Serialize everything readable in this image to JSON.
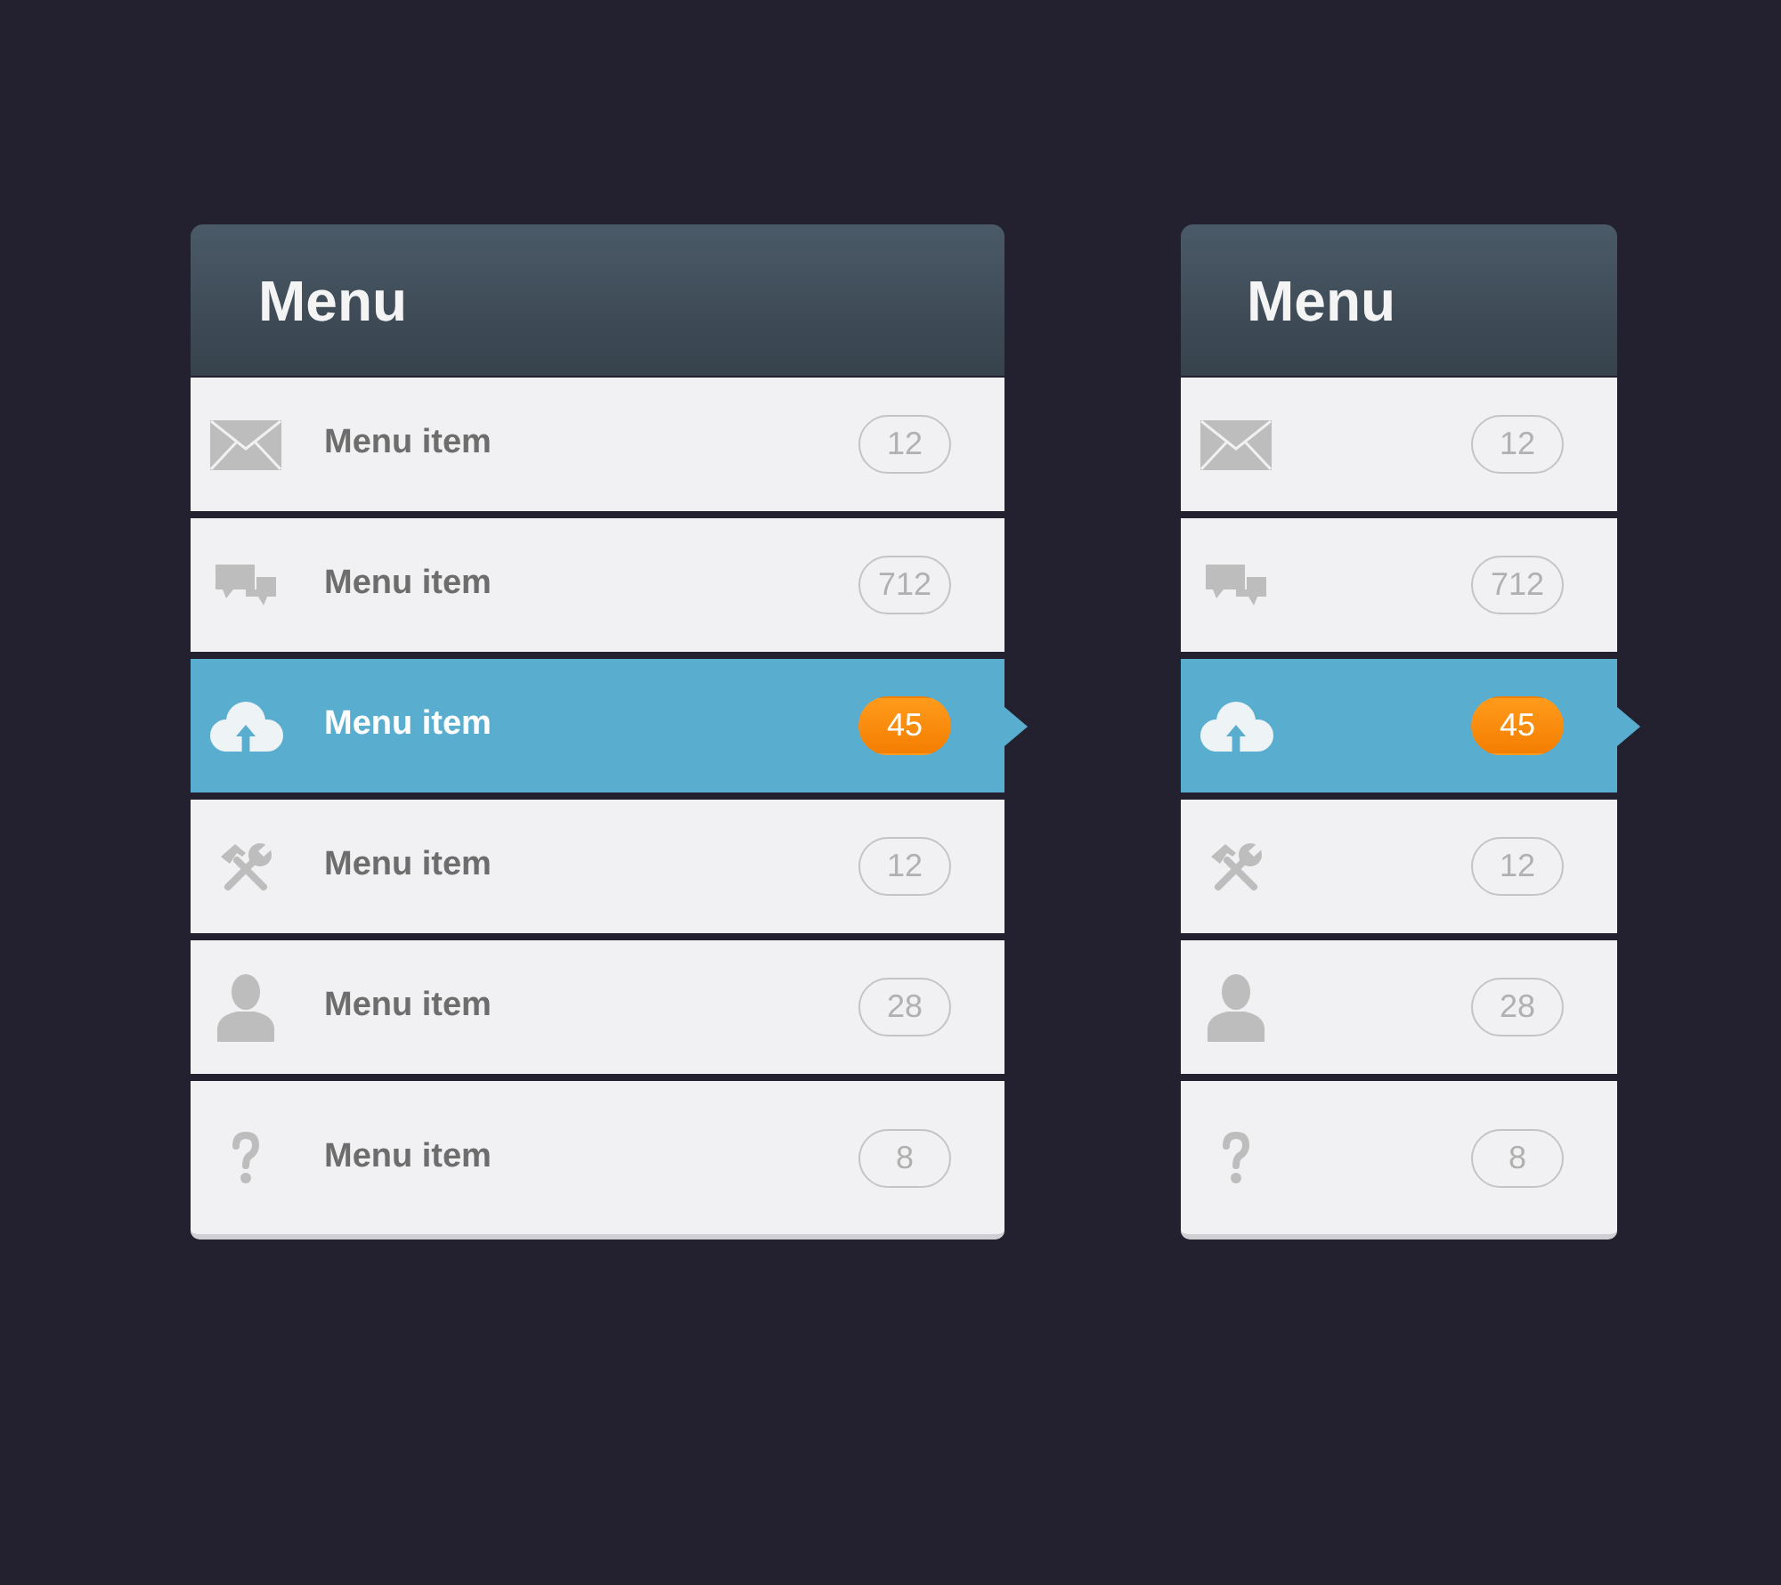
{
  "menus": [
    {
      "title": "Menu",
      "items": [
        {
          "label": "Menu item",
          "count": "12",
          "selected": false
        },
        {
          "label": "Menu item",
          "count": "712",
          "selected": false
        },
        {
          "label": "Menu item",
          "count": "45",
          "selected": true
        },
        {
          "label": "Menu item",
          "count": "12",
          "selected": false
        },
        {
          "label": "Menu item",
          "count": "28",
          "selected": false
        },
        {
          "label": "Menu item",
          "count": "8",
          "selected": false
        }
      ]
    },
    {
      "title": "Menu",
      "items": [
        {
          "count": "12",
          "selected": false
        },
        {
          "count": "712",
          "selected": false
        },
        {
          "count": "45",
          "selected": true
        },
        {
          "count": "12",
          "selected": false
        },
        {
          "count": "28",
          "selected": false
        },
        {
          "count": "8",
          "selected": false
        }
      ]
    }
  ]
}
